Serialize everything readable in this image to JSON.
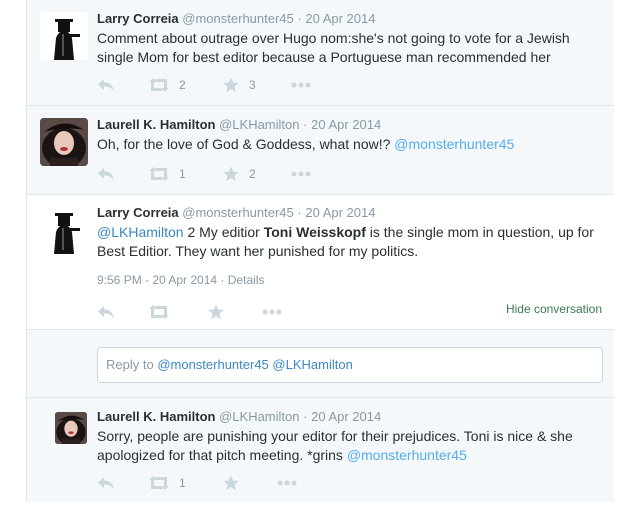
{
  "tweets": [
    {
      "name": "Larry Correia",
      "handle": "@monsterhunter45",
      "sep": "·",
      "date": "20 Apr 2014",
      "text": "Comment about outrage over Hugo nom:she's not going to vote for a Jewish single Mom for best editor because a Portuguese man recommended her",
      "retweets": "2",
      "favorites": "3"
    },
    {
      "name": "Laurell K. Hamilton",
      "handle": "@LKHamilton",
      "sep": "·",
      "date": "20 Apr 2014",
      "text_before": "Oh, for the love of God & Goddess, what now!? ",
      "text_mention": "@monsterhunter45",
      "retweets": "1",
      "favorites": "2"
    },
    {
      "name": "Larry Correia",
      "handle": "@monsterhunter45",
      "sep": "·",
      "date": "20 Apr 2014",
      "text_mention": "@LKHamilton",
      "text_mid": " 2 My editior ",
      "text_bold": "Toni Weisskopf",
      "text_after": " is the single mom in question, up for Best Editior. They want her punished for my politics.",
      "meta_time": "9:56 PM - 20 Apr 2014",
      "meta_sep": "·",
      "meta_details": "Details",
      "hide_conversation": "Hide conversation"
    },
    {
      "name": "Laurell K. Hamilton",
      "handle": "@LKHamilton",
      "sep": "·",
      "date": "20 Apr 2014",
      "text_before": "Sorry, people are punishing your editor for their prejudices. Toni is nice & she apologized for that pitch meeting. *grins ",
      "text_mention": "@monsterhunter45",
      "retweets": "1"
    }
  ],
  "reply_box": {
    "prefix": "Reply to ",
    "mention1": "@monsterhunter45",
    "space": " ",
    "mention2": "@LKHamilton"
  },
  "colors": {
    "accent": "#55acee",
    "hide_conversation": "#3b7a4d",
    "muted": "#8899a6"
  },
  "icons": [
    "reply-icon",
    "retweet-icon",
    "favorite-star-icon",
    "more-dots-icon"
  ]
}
